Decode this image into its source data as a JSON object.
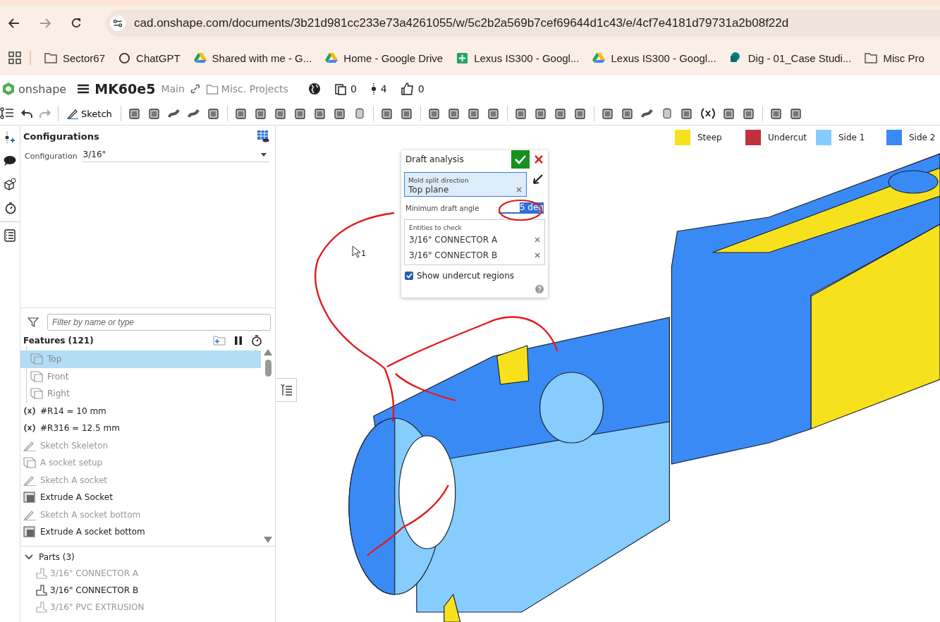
{
  "browser": {
    "url": "cad.onshape.com/documents/3b21d981cc233e73a4261055/w/5c2b2a569b7cef69644d1c43/e/4cf7e4181d79731a2b08f22d",
    "bookmarks": [
      {
        "label": "Sector67",
        "kind": "folder"
      },
      {
        "label": "ChatGPT",
        "kind": "chat"
      },
      {
        "label": "Shared with me - G...",
        "kind": "drive"
      },
      {
        "label": "Home - Google Drive",
        "kind": "drive"
      },
      {
        "label": "Lexus IS300 - Googl...",
        "kind": "sheet"
      },
      {
        "label": "Lexus IS300 - Googl...",
        "kind": "drive"
      },
      {
        "label": "Dig - 01_Case Studi...",
        "kind": "sharepoint"
      },
      {
        "label": "Misc Pro",
        "kind": "folder"
      }
    ]
  },
  "header": {
    "logo": "onshape",
    "document": "MK60e5",
    "branch": "Main",
    "folder": "Misc. Projects",
    "counts": [
      "0",
      "4",
      "0"
    ]
  },
  "toolbar": {
    "sketch": "Sketch"
  },
  "legend": [
    {
      "label": "Steep",
      "color": "#f7e11c"
    },
    {
      "label": "Undercut",
      "color": "#c0313b"
    },
    {
      "label": "Side 1",
      "color": "#86cdfd"
    },
    {
      "label": "Side 2",
      "color": "#3a8af6"
    }
  ],
  "configurations": {
    "title": "Configurations",
    "label": "Configuration",
    "value": "3/16\""
  },
  "filter": {
    "placeholder": "Filter by name or type"
  },
  "features": {
    "title": "Features (121)",
    "planes": [
      {
        "label": "Top",
        "selected": true
      },
      {
        "label": "Front",
        "selected": false
      },
      {
        "label": "Right",
        "selected": false
      }
    ],
    "items": [
      {
        "label": "#R14 = 10 mm",
        "kind": "variable",
        "hidden": false
      },
      {
        "label": "#R316 = 12.5 mm",
        "kind": "variable",
        "hidden": false
      },
      {
        "label": "Sketch Skeleton",
        "kind": "sketch",
        "hidden": true
      },
      {
        "label": "A socket setup",
        "kind": "plane",
        "hidden": true
      },
      {
        "label": "Sketch A socket",
        "kind": "sketch",
        "hidden": true
      },
      {
        "label": "Extrude A Socket",
        "kind": "extrude",
        "hidden": false
      },
      {
        "label": "Sketch A socket bottom",
        "kind": "sketch",
        "hidden": true
      },
      {
        "label": "Extrude A socket bottom",
        "kind": "extrude",
        "hidden": false
      }
    ]
  },
  "parts": {
    "title": "Parts (3)",
    "expanded": true,
    "items": [
      {
        "label": "3/16\" CONNECTOR A",
        "hidden": true
      },
      {
        "label": "3/16\" CONNECTOR B",
        "hidden": false
      },
      {
        "label": "3/16\" PVC EXTRUSION",
        "hidden": true
      }
    ]
  },
  "dialog": {
    "title": "Draft analysis",
    "direction_label": "Mold split direction",
    "direction_value": "Top plane",
    "angle_label": "Minimum draft angle",
    "angle_value": "5 deg",
    "entities_label": "Entities to check",
    "entities": [
      "3/16\" CONNECTOR A",
      "3/16\" CONNECTOR B"
    ],
    "undercut_label": "Show undercut regions",
    "undercut_checked": true
  },
  "cursor_badge": "1"
}
